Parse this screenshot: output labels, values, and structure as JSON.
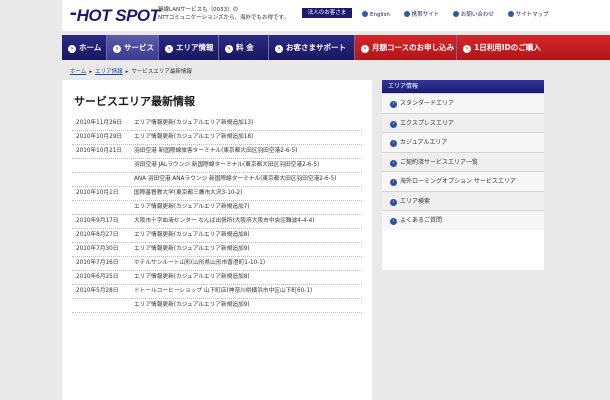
{
  "header": {
    "logo": "HOT SPOT",
    "tagline_line1": "無線LANサービスも（0033）の",
    "tagline_line2": "NTTコミュニケーションズから、海外でもお得です。",
    "corp_button": "法人のお客さま",
    "util_links": [
      "English",
      "携帯サイト",
      "お問い合わせ",
      "サイトマップ"
    ]
  },
  "nav": {
    "items": [
      {
        "label": "ホーム",
        "style": "blue"
      },
      {
        "label": "サービス",
        "style": "active"
      },
      {
        "label": "エリア情報",
        "style": "blue"
      },
      {
        "label": "料 金",
        "style": "blue"
      },
      {
        "label": "お客さまサポート",
        "style": "blue"
      },
      {
        "label": "月額コースのお申し込み",
        "style": "red"
      },
      {
        "label": "1日利用IDのご購入",
        "style": "red"
      }
    ]
  },
  "breadcrumb": {
    "home": "ホーム",
    "area": "エリア情報",
    "current": "サービスエリア最新情報"
  },
  "main": {
    "title": "サービスエリア最新情報",
    "news": [
      {
        "date": "2010年11月26日",
        "text": "エリア情報更新(カジュアルエリア新規追加13)"
      },
      {
        "date": "2010年10月29日",
        "text": "エリア情報更新(カジュアルエリア新規追加18)"
      },
      {
        "date": "2010年10月21日",
        "text": "羽田空港 新国際線旅客ターミナル(東京都大田区羽田空港2-6-5)"
      },
      {
        "date": "",
        "text": "羽田空港 JALラウンジ 新国際線ターミナル(東京都大田区羽田空港2-6-5)"
      },
      {
        "date": "",
        "text": "ANA 羽田空港 ANAラウンジ 新国際線ターミナル(東京都大田区羽田空港2-6-5)"
      },
      {
        "date": "2010年10月1日",
        "text": "国際基督教大学(東京都三鷹市大沢3-10-2)"
      },
      {
        "date": "",
        "text": "エリア情報更新(カジュアルエリア新規追加7)"
      },
      {
        "date": "2010年9月17日",
        "text": "大阪市十字血液センター なんば出張所(大阪府大阪市中央区難波4-4-4)"
      },
      {
        "date": "2010年8月27日",
        "text": "エリア情報更新(カジュアルエリア新規追加8)"
      },
      {
        "date": "2010年7月30日",
        "text": "エリア情報更新(カジュアルエリア新規追加9)"
      },
      {
        "date": "2010年7月16日",
        "text": "ホテルサンルート山形(山形県山形市香澄町1-10-1)"
      },
      {
        "date": "2010年6月25日",
        "text": "エリア情報更新(カジュアルエリア新規追加8)"
      },
      {
        "date": "2010年5月28日",
        "text": "ドトールコーヒーショップ 山下町店(神奈川県横浜市中区山下町60-1)"
      },
      {
        "date": "",
        "text": "エリア情報更新(カジュアルエリア新規追加9)"
      }
    ]
  },
  "sidebar": {
    "heading": "エリア情報",
    "items": [
      "スタンダードエリア",
      "エクスプレスエリア",
      "カジュアルエリア",
      "ご契約済サービスエリア一覧",
      "海外ローミングオプション サービスエリア",
      "エリア検索",
      "よくあるご質問"
    ]
  },
  "colors": {
    "brand_navy": "#1c1a6e",
    "nav_active": "#4a4a9c",
    "nav_red": "#c21a1d",
    "link_blue": "#1c4c9c"
  }
}
